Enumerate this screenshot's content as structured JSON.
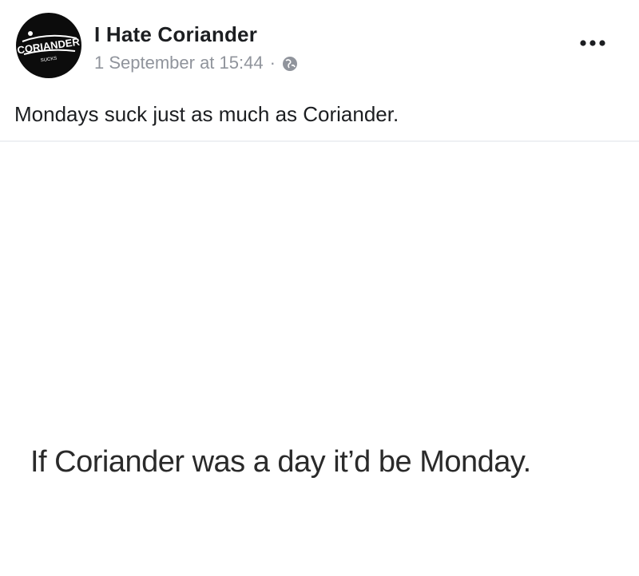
{
  "post": {
    "page_name": "I Hate Coriander",
    "timestamp": "1 September at 15:44",
    "separator": "·",
    "privacy_icon": "globe-icon",
    "more_icon": "more-options-icon",
    "text": "Mondays suck just as much as Coriander."
  },
  "avatar": {
    "logo_text": "CORIANDER",
    "logo_subtext": "SUCKS"
  },
  "image": {
    "caption": "If Coriander was a day it’d be Monday."
  },
  "colors": {
    "text": "#1c1e21",
    "meta_text": "#90949c",
    "avatar_bg": "#0c0c0c"
  }
}
